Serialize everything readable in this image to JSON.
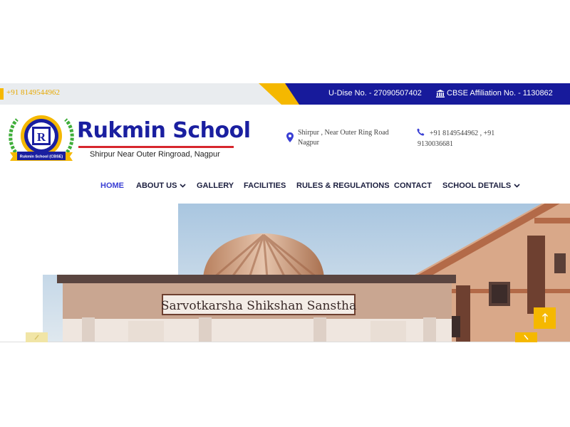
{
  "topbar": {
    "phone": "+91 8149544962",
    "udise": "U-Dise No. - 27090507402",
    "cbse": "CBSE Affiliation No. - 1130862",
    "cbse_icon": "bank-icon"
  },
  "header": {
    "brand": "Rukmin School",
    "tagline": "Shirpur Near Outer Ringroad, Nagpur",
    "logo_badge_letter": "R",
    "logo_ribbon": "Rukmin School (CBSE)",
    "address": "Shirpur , Near Outer Ring Road Nagpur",
    "phones": "+91 8149544962 , +91 9130036681"
  },
  "nav": {
    "items": [
      {
        "label": "HOME",
        "active": true,
        "dropdown": false
      },
      {
        "label": "ABOUT US",
        "active": false,
        "dropdown": true
      },
      {
        "label": "GALLERY",
        "active": false,
        "dropdown": false
      },
      {
        "label": "FACILITIES",
        "active": false,
        "dropdown": false
      },
      {
        "label": "RULES & REGULATIONS",
        "active": false,
        "dropdown": false
      },
      {
        "label": "CONTACT",
        "active": false,
        "dropdown": false
      },
      {
        "label": "SCHOOL DETAILS",
        "active": false,
        "dropdown": true
      }
    ]
  },
  "hero": {
    "sign_text": "Sarvotkarsha Shikshan Sanstha"
  },
  "colors": {
    "navy": "#171a9b",
    "yellow": "#f5b800",
    "red": "#d7262d",
    "nav_active": "#3a3fd4"
  }
}
